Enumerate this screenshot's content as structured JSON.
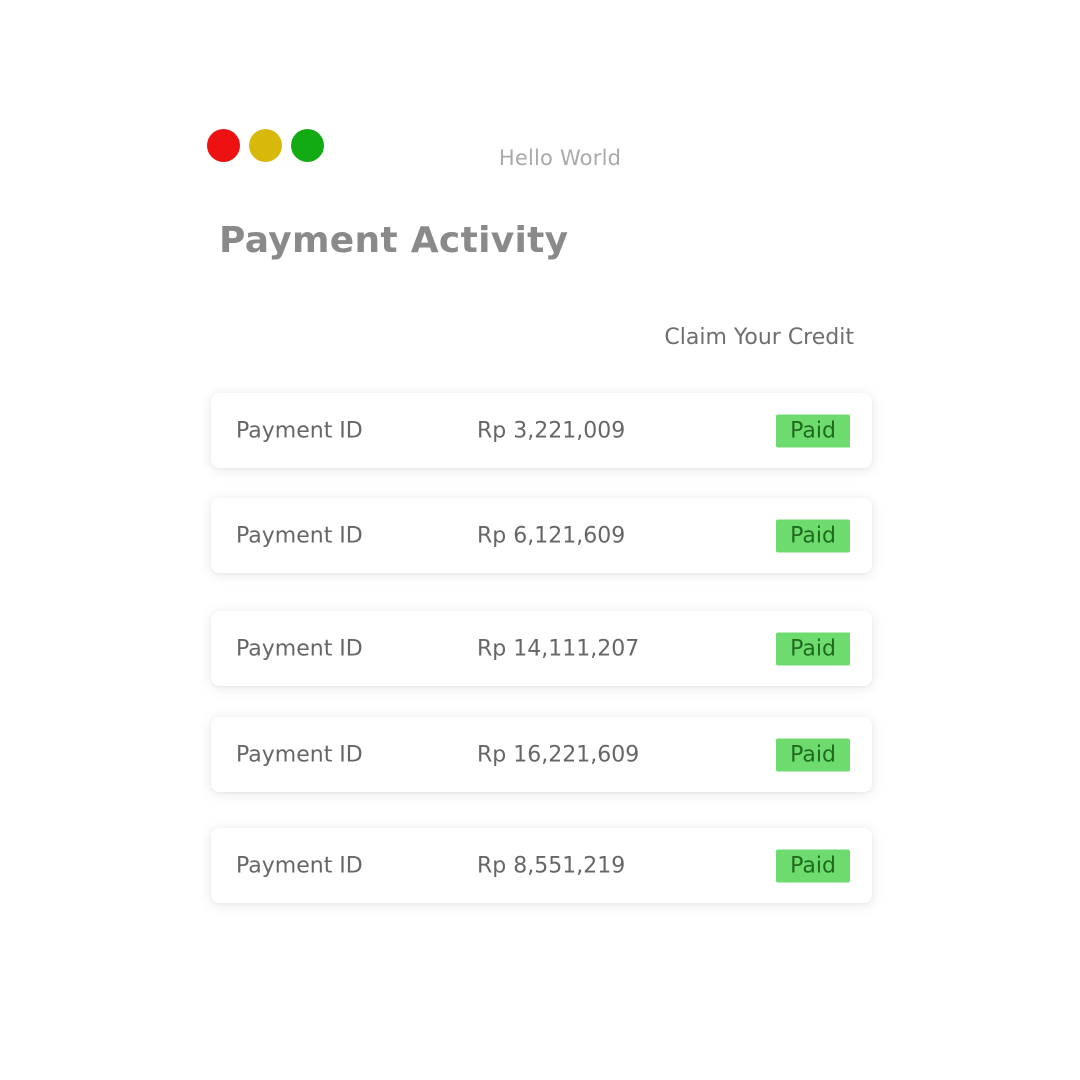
{
  "window": {
    "title": "Hello World",
    "controls": [
      {
        "name": "close",
        "color": "#ee1111"
      },
      {
        "name": "minimize",
        "color": "#d8b80a"
      },
      {
        "name": "maximize",
        "color": "#13ab13"
      }
    ]
  },
  "page": {
    "title": "Payment Activity",
    "claim_link": "Claim Your Credit"
  },
  "colors": {
    "badge_bg": "#6ddb6d",
    "badge_text": "#1f6b1f"
  },
  "payments": [
    {
      "label": "Payment ID",
      "amount": "Rp 3,221,009",
      "status": "Paid"
    },
    {
      "label": "Payment ID",
      "amount": "Rp 6,121,609",
      "status": "Paid"
    },
    {
      "label": "Payment ID",
      "amount": "Rp 14,111,207",
      "status": "Paid"
    },
    {
      "label": "Payment ID",
      "amount": "Rp 16,221,609",
      "status": "Paid"
    },
    {
      "label": "Payment ID",
      "amount": "Rp 8,551,219",
      "status": "Paid"
    }
  ]
}
